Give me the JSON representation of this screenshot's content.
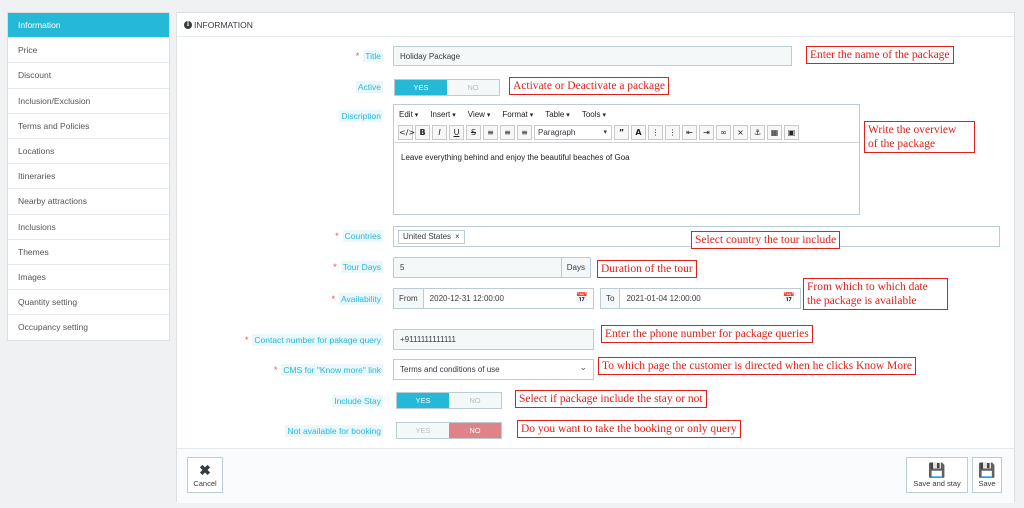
{
  "sidebar": {
    "items": [
      {
        "label": "Information",
        "active": true
      },
      {
        "label": "Price"
      },
      {
        "label": "Discount"
      },
      {
        "label": "Inclusion/Exclusion"
      },
      {
        "label": "Terms and Policies"
      },
      {
        "label": "Locations"
      },
      {
        "label": "Itineraries"
      },
      {
        "label": "Nearby attractions"
      },
      {
        "label": "Inclusions"
      },
      {
        "label": "Themes"
      },
      {
        "label": "Images"
      },
      {
        "label": "Quantity setting"
      },
      {
        "label": "Occupancy setting"
      }
    ]
  },
  "panel": {
    "heading": "INFORMATION"
  },
  "form": {
    "title": {
      "label": "Title",
      "value": "Holiday Package"
    },
    "active": {
      "label": "Active",
      "yes": "YES",
      "no": "NO"
    },
    "description": {
      "label": "Discription",
      "menus": [
        "Edit",
        "Insert",
        "View",
        "Format",
        "Table",
        "Tools"
      ],
      "format_select": "Paragraph",
      "content": "Leave everything behind and enjoy the beautiful beaches of Goa"
    },
    "countries": {
      "label": "Countries",
      "tag": "United States",
      "tag_remove": "×"
    },
    "tour_days": {
      "label": "Tour Days",
      "value": "5",
      "unit": "Days"
    },
    "availability": {
      "label": "Availability",
      "from_label": "From",
      "from_value": "2020-12-31 12:00:00",
      "to_label": "To",
      "to_value": "2021-01-04 12:00:00"
    },
    "contact": {
      "label": "Contact number for pakage query",
      "value": "+9111111111111"
    },
    "cms": {
      "label": "CMS for \"Know more\" link",
      "value": "Terms and conditions of use"
    },
    "include_stay": {
      "label": "Include Stay",
      "yes": "YES",
      "no": "NO"
    },
    "not_available": {
      "label": "Not available for booking",
      "yes": "YES",
      "no": "NO"
    }
  },
  "notes": {
    "title": "Enter the name of the package",
    "active": "Activate or Deactivate a package",
    "overview_1": "Write the overview",
    "overview_2": "of the package",
    "countries": "Select country the tour include",
    "duration": "Duration of the tour",
    "availability_1": "From which to which date",
    "availability_2": "the package is available",
    "phone": "Enter the phone number for package queries",
    "cms": "To which page the customer is directed when he clicks Know More",
    "stay": "Select if package include the stay or not",
    "booking": "Do you want to take the booking or only query"
  },
  "footer": {
    "cancel": "Cancel",
    "save_stay": "Save and stay",
    "save": "Save"
  },
  "colors": {
    "accent": "#25b9d7",
    "annotation": "#e0201b",
    "danger_toggle": "#e08288"
  }
}
